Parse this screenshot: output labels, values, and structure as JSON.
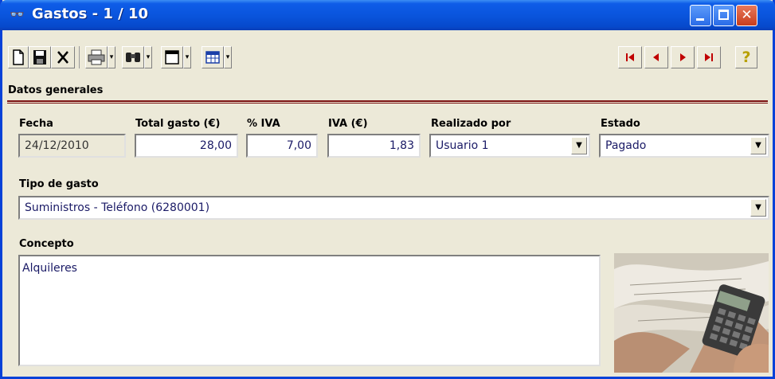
{
  "window": {
    "title": "Gastos - 1 / 10",
    "title_color": "#0A55DD",
    "close_color": "#C83D1D"
  },
  "toolbar": {
    "buttons": [
      {
        "name": "new-icon",
        "glyph": "🗋"
      },
      {
        "name": "save-icon",
        "glyph": "💾"
      },
      {
        "name": "delete-icon",
        "glyph": "✕"
      },
      {
        "name": "print-icon",
        "glyph": "🖶"
      },
      {
        "name": "binoculars-icon",
        "glyph": "👀"
      },
      {
        "name": "window-icon",
        "glyph": "▭"
      },
      {
        "name": "table-icon",
        "glyph": "▦"
      }
    ],
    "nav": {
      "first": "⏮",
      "prev": "◀",
      "next": "▶",
      "last": "⏭"
    },
    "help": "?"
  },
  "section": {
    "title": "Datos generales",
    "color": "#7A1010"
  },
  "form": {
    "fecha": {
      "label": "Fecha",
      "value": "24/12/2010"
    },
    "total": {
      "label": "Total gasto (€)",
      "value": "28,00"
    },
    "pct_iva": {
      "label": "% IVA",
      "value": "7,00"
    },
    "iva": {
      "label": "IVA (€)",
      "value": "1,83"
    },
    "realizado": {
      "label": "Realizado por",
      "value": "Usuario 1"
    },
    "estado": {
      "label": "Estado",
      "value": "Pagado"
    },
    "tipo": {
      "label": "Tipo de gasto",
      "value": "Suministros - Teléfono (6280001)"
    },
    "concepto": {
      "label": "Concepto",
      "value": "Alquileres"
    }
  }
}
